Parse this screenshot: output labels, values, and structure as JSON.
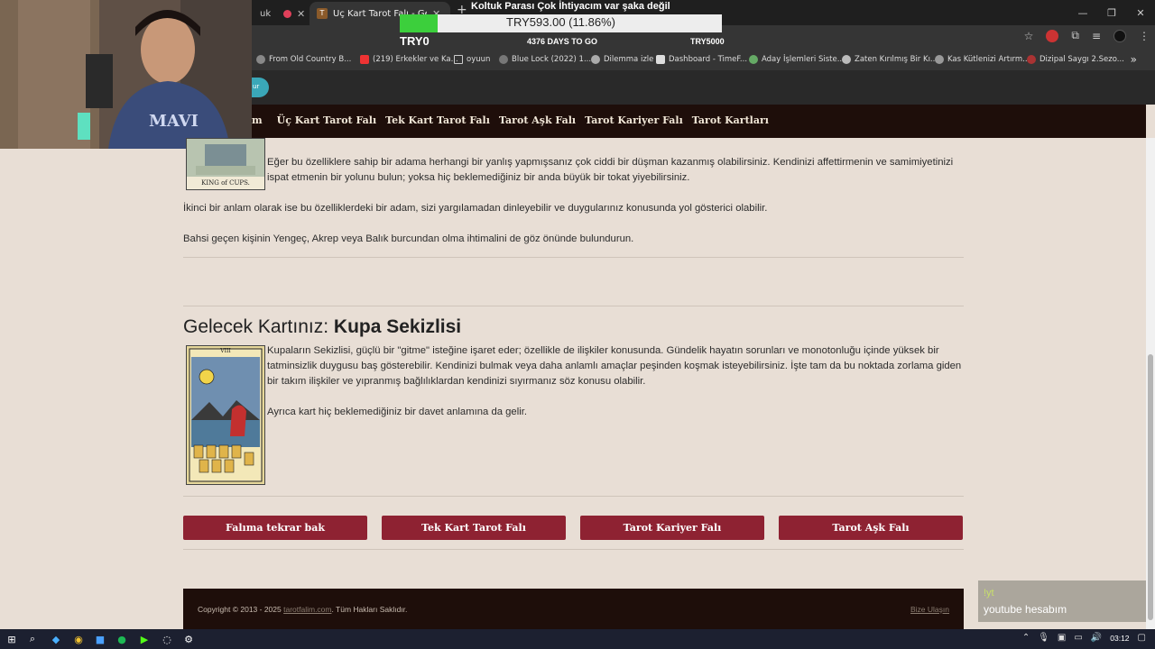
{
  "browser": {
    "tabs": [
      {
        "label": "uk",
        "close": "✕"
      },
      {
        "label": "",
        "close": "✕"
      },
      {
        "label": "Üç Kart Tarot Falı - Geçmiş",
        "close": "✕"
      }
    ],
    "new_tab": "+",
    "window_controls": [
      "—",
      "❐",
      "✕"
    ],
    "bookmarks": [
      "From Old Country B...",
      "(219) Erkekler ve Ka...",
      "oyuun",
      "Blue Lock (2022) 1...",
      "Dilemma izle",
      "Dashboard - TimeF...",
      "Aday İşlemleri Siste...",
      "Zaten Kırılmış Bir Kı...",
      "Kas Kütlenizi Artırm...",
      "Dizipal Saygı 2.Sezo..."
    ],
    "bookmarks_more": "»",
    "info_pill": "ur"
  },
  "overlay": {
    "goal_title": "Koltuk Parası Çok İhtiyacım var şaka değil",
    "goal_amount": "TRY593.00 (11.86%)",
    "goal_progress_pct": 11.86,
    "goal_start": "TRY0",
    "goal_days": "4376 DAYS TO GO",
    "goal_target": "TRY5000",
    "yt_line1": "!yt",
    "yt_line2": "youtube hesabım"
  },
  "nav": {
    "brand_fragment": "m",
    "links": [
      "Üç Kart Tarot Falı",
      "Tek Kart Tarot Falı",
      "Tarot Aşk Falı",
      "Tarot Kariyer Falı",
      "Tarot Kartları"
    ]
  },
  "section_prev": {
    "card_caption": "KING of CUPS.",
    "p1": "Eğer bu özelliklere sahip bir adama herhangi bir yanlış yapmışsanız çok ciddi bir düşman kazanmış olabilirsiniz. Kendinizi affettirmenin ve samimiyetinizi ispat etmenin bir yolunu bulun; yoksa hiç beklemediğiniz bir anda büyük bir tokat yiyebilirsiniz.",
    "p2": "İkinci bir anlam olarak ise bu özelliklerdeki bir adam, sizi yargılamadan dinleyebilir ve duygularınız konusunda yol gösterici olabilir.",
    "p3": "Bahsi geçen kişinin Yengeç, Akrep veya Balık burcundan olma ihtimalini de göz önünde bulundurun."
  },
  "section_future": {
    "heading_prefix": "Gelecek Kartınız: ",
    "heading_card": "Kupa Sekizlisi",
    "card_numeral": "VIII",
    "p1": "Kupaların Sekizlisi, güçlü bir \"gitme\" isteğine işaret eder; özellikle de ilişkiler konusunda. Gündelik hayatın sorunları ve monotonluğu içinde yüksek bir tatminsizlik duygusu baş gösterebilir. Kendinizi bulmak veya daha anlamlı amaçlar peşinden koşmak isteyebilirsiniz. İşte tam da bu noktada zorlama giden bir takım ilişkiler ve yıpranmış bağlılıklardan kendinizi sıyırmanız söz konusu olabilir.",
    "p2": "Ayrıca kart hiç beklemediğiniz bir davet anlamına da gelir."
  },
  "buttons": [
    "Falıma tekrar bak",
    "Tek Kart Tarot Falı",
    "Tarot Kariyer Falı",
    "Tarot Aşk Falı"
  ],
  "footer": {
    "copyright_pre": "Copyright © 2013 - 2025 ",
    "site": "tarotfalim.com",
    "copyright_post": ". Tüm Hakları Saklıdır.",
    "contact": "Bize Ulaşın"
  },
  "taskbar": {
    "clock": "03:12"
  },
  "colors": {
    "page_bg": "#e8ded5",
    "nav_bg": "#1e0e0a",
    "button_bg": "#8e2232",
    "goal_fill": "#3ccf3c"
  }
}
